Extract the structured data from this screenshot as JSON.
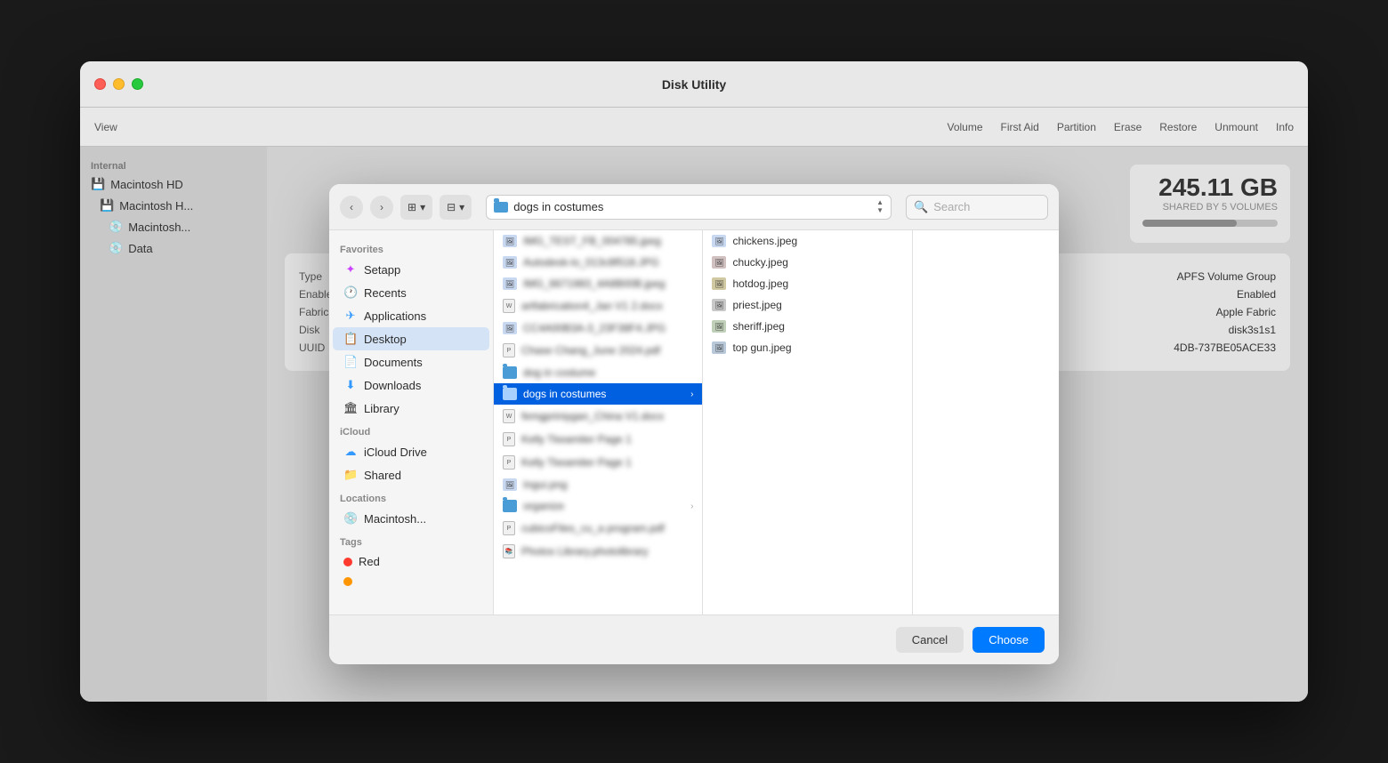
{
  "window": {
    "title": "Disk Utility",
    "traffic_lights": [
      "close",
      "minimize",
      "maximize"
    ]
  },
  "toolbar": {
    "view_label": "View",
    "volume_label": "Volume",
    "first_aid_label": "First Aid",
    "partition_label": "Partition",
    "erase_label": "Erase",
    "restore_label": "Restore",
    "unmount_label": "Unmount",
    "info_label": "Info"
  },
  "internal_sidebar": {
    "section": "Internal",
    "items": [
      {
        "label": "Macintosh HD",
        "icon": "💾",
        "indent": 0
      },
      {
        "label": "Macintosh H...",
        "icon": "💾",
        "indent": 1
      },
      {
        "label": "Macintosh...",
        "icon": "💿",
        "indent": 2
      },
      {
        "label": "Data",
        "icon": "💿",
        "indent": 2
      }
    ]
  },
  "disk_detail": {
    "size": "245.11 GB",
    "size_label": "SHARED BY 5 VOLUMES",
    "type_label": "APFS Volume Group",
    "enabled_label": "Enabled",
    "fabric_label": "Apple Fabric",
    "disk_id": "disk3s1s1",
    "uuid": "4DB-737BE05ACE33",
    "progress": 70
  },
  "dialog": {
    "current_folder": "dogs in costumes",
    "search_placeholder": "Search",
    "sidebar": {
      "favorites_label": "Favorites",
      "icloud_label": "iCloud",
      "locations_label": "Locations",
      "tags_label": "Tags",
      "items": [
        {
          "label": "Setapp",
          "icon": "✦",
          "color": "#cc44ff",
          "section": "favorites"
        },
        {
          "label": "Recents",
          "icon": "🕐",
          "color": "#3399ff",
          "section": "favorites"
        },
        {
          "label": "Applications",
          "icon": "✈",
          "color": "#3399ff",
          "section": "favorites"
        },
        {
          "label": "Desktop",
          "icon": "📋",
          "color": "#3399ff",
          "section": "favorites",
          "active": true
        },
        {
          "label": "Documents",
          "icon": "📄",
          "color": "#555",
          "section": "favorites"
        },
        {
          "label": "Downloads",
          "icon": "⬇",
          "color": "#3399ff",
          "section": "favorites"
        },
        {
          "label": "Library",
          "icon": "🏛",
          "color": "#555",
          "section": "favorites"
        },
        {
          "label": "iCloud Drive",
          "icon": "☁",
          "color": "#3399ff",
          "section": "icloud"
        },
        {
          "label": "Shared",
          "icon": "📁",
          "color": "#555",
          "section": "icloud"
        },
        {
          "label": "Macintosh...",
          "icon": "💿",
          "color": "#555",
          "section": "locations"
        },
        {
          "label": "Red",
          "icon": "●",
          "color": "#ff3b30",
          "section": "tags"
        }
      ]
    },
    "left_pane_files": [
      {
        "name": "IMG_TEST_FB_004785.jpeg",
        "type": "img",
        "blurred": true
      },
      {
        "name": "Autodesk-lo_013c8f518.JPG",
        "type": "img",
        "blurred": true
      },
      {
        "name": "IMG_6671983_4A8B00B.jpeg",
        "type": "img",
        "blurred": true
      },
      {
        "name": "artfabrication4_Jan V1 2.docx",
        "type": "doc",
        "blurred": true
      },
      {
        "name": "CC4A00B3A-3_23F38F4.JPG",
        "type": "img",
        "blurred": true
      },
      {
        "name": "Chase Chang_June 2024.pdf",
        "type": "doc",
        "blurred": true
      },
      {
        "name": "dog in costume",
        "type": "folder",
        "blurred": true
      },
      {
        "name": "dogs in costumes",
        "type": "folder",
        "selected": true
      },
      {
        "name": "femgpriniygan_China V1.docx",
        "type": "doc",
        "blurred": true
      },
      {
        "name": "Kelly Tkeamiter Page 1",
        "type": "doc",
        "blurred": true
      },
      {
        "name": "Kelly Tkeamiter Page 1",
        "type": "doc",
        "blurred": true
      },
      {
        "name": "Ingui.png",
        "type": "img",
        "blurred": true
      },
      {
        "name": "organize",
        "type": "folder",
        "blurred": true
      },
      {
        "name": "cubicoFiles_cu_a program.pdf",
        "type": "doc",
        "blurred": true
      },
      {
        "name": "Photos Library.photolibrary",
        "type": "doc",
        "blurred": true
      }
    ],
    "right_pane_files": [
      {
        "name": "chickens.jpeg",
        "type": "img"
      },
      {
        "name": "chucky.jpeg",
        "type": "img"
      },
      {
        "name": "hotdog.jpeg",
        "type": "img"
      },
      {
        "name": "priest.jpeg",
        "type": "img"
      },
      {
        "name": "sheriff.jpeg",
        "type": "img"
      },
      {
        "name": "top gun.jpeg",
        "type": "img"
      }
    ],
    "buttons": {
      "cancel": "Cancel",
      "choose": "Choose"
    }
  }
}
